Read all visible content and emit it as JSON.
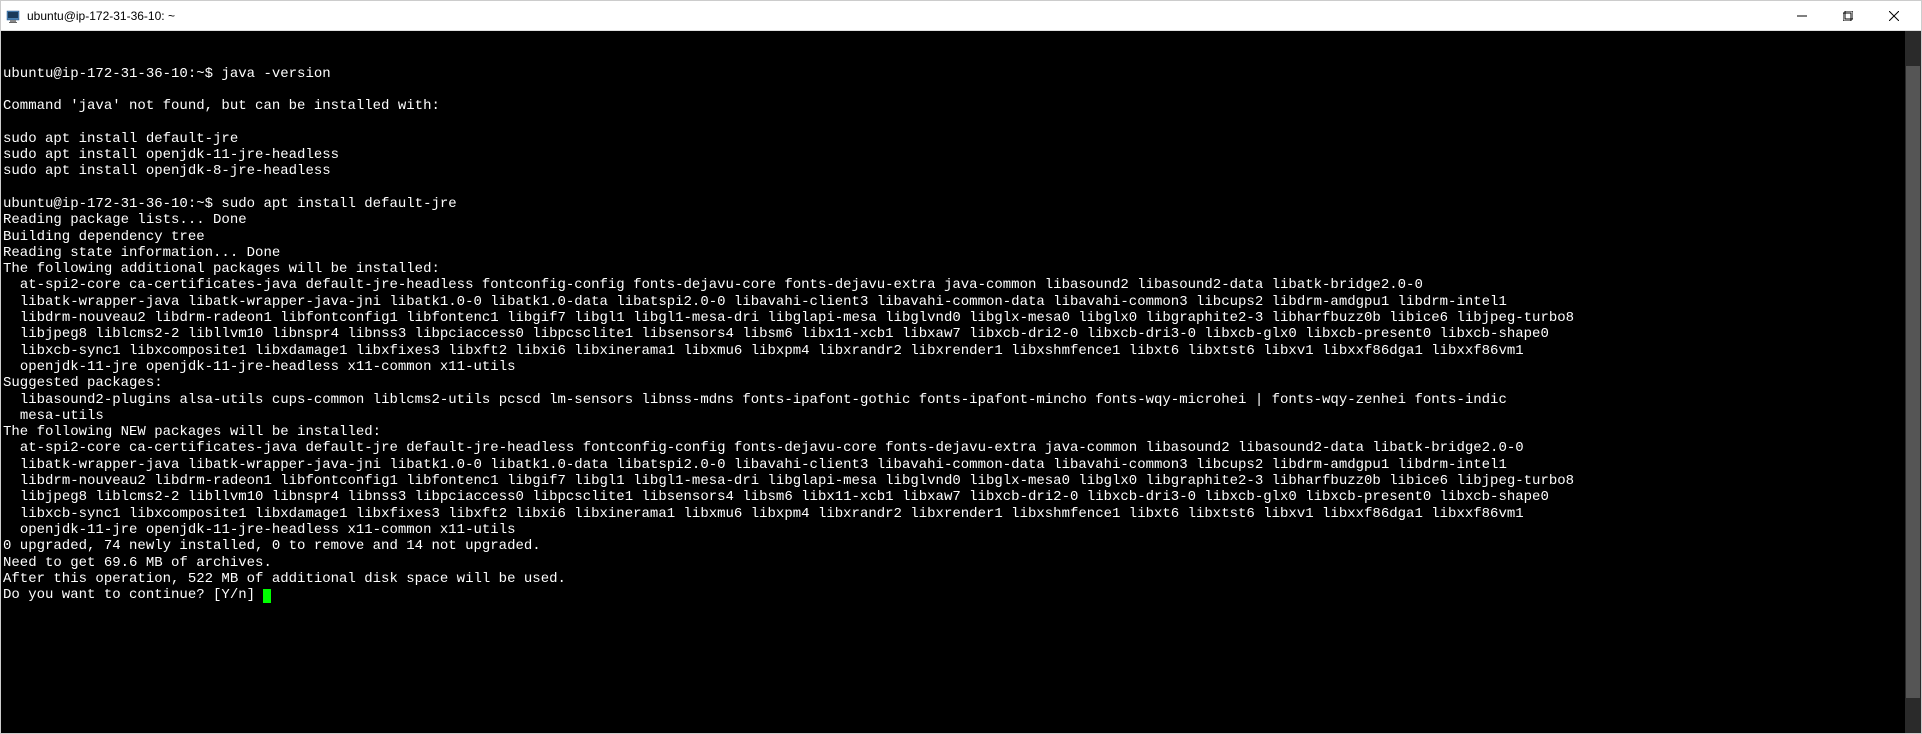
{
  "window": {
    "title": "ubuntu@ip-172-31-36-10: ~"
  },
  "terminal": {
    "lines": [
      "ubuntu@ip-172-31-36-10:~$ java -version",
      "",
      "Command 'java' not found, but can be installed with:",
      "",
      "sudo apt install default-jre",
      "sudo apt install openjdk-11-jre-headless",
      "sudo apt install openjdk-8-jre-headless",
      "",
      "ubuntu@ip-172-31-36-10:~$ sudo apt install default-jre",
      "Reading package lists... Done",
      "Building dependency tree",
      "Reading state information... Done",
      "The following additional packages will be installed:",
      "  at-spi2-core ca-certificates-java default-jre-headless fontconfig-config fonts-dejavu-core fonts-dejavu-extra java-common libasound2 libasound2-data libatk-bridge2.0-0",
      "  libatk-wrapper-java libatk-wrapper-java-jni libatk1.0-0 libatk1.0-data libatspi2.0-0 libavahi-client3 libavahi-common-data libavahi-common3 libcups2 libdrm-amdgpu1 libdrm-intel1",
      "  libdrm-nouveau2 libdrm-radeon1 libfontconfig1 libfontenc1 libgif7 libgl1 libgl1-mesa-dri libglapi-mesa libglvnd0 libglx-mesa0 libglx0 libgraphite2-3 libharfbuzz0b libice6 libjpeg-turbo8",
      "  libjpeg8 liblcms2-2 libllvm10 libnspr4 libnss3 libpciaccess0 libpcsclite1 libsensors4 libsm6 libx11-xcb1 libxaw7 libxcb-dri2-0 libxcb-dri3-0 libxcb-glx0 libxcb-present0 libxcb-shape0",
      "  libxcb-sync1 libxcomposite1 libxdamage1 libxfixes3 libxft2 libxi6 libxinerama1 libxmu6 libxpm4 libxrandr2 libxrender1 libxshmfence1 libxt6 libxtst6 libxv1 libxxf86dga1 libxxf86vm1",
      "  openjdk-11-jre openjdk-11-jre-headless x11-common x11-utils",
      "Suggested packages:",
      "  libasound2-plugins alsa-utils cups-common liblcms2-utils pcscd lm-sensors libnss-mdns fonts-ipafont-gothic fonts-ipafont-mincho fonts-wqy-microhei | fonts-wqy-zenhei fonts-indic",
      "  mesa-utils",
      "The following NEW packages will be installed:",
      "  at-spi2-core ca-certificates-java default-jre default-jre-headless fontconfig-config fonts-dejavu-core fonts-dejavu-extra java-common libasound2 libasound2-data libatk-bridge2.0-0",
      "  libatk-wrapper-java libatk-wrapper-java-jni libatk1.0-0 libatk1.0-data libatspi2.0-0 libavahi-client3 libavahi-common-data libavahi-common3 libcups2 libdrm-amdgpu1 libdrm-intel1",
      "  libdrm-nouveau2 libdrm-radeon1 libfontconfig1 libfontenc1 libgif7 libgl1 libgl1-mesa-dri libglapi-mesa libglvnd0 libglx-mesa0 libglx0 libgraphite2-3 libharfbuzz0b libice6 libjpeg-turbo8",
      "  libjpeg8 liblcms2-2 libllvm10 libnspr4 libnss3 libpciaccess0 libpcsclite1 libsensors4 libsm6 libx11-xcb1 libxaw7 libxcb-dri2-0 libxcb-dri3-0 libxcb-glx0 libxcb-present0 libxcb-shape0",
      "  libxcb-sync1 libxcomposite1 libxdamage1 libxfixes3 libxft2 libxi6 libxinerama1 libxmu6 libxpm4 libxrandr2 libxrender1 libxshmfence1 libxt6 libxtst6 libxv1 libxxf86dga1 libxxf86vm1",
      "  openjdk-11-jre openjdk-11-jre-headless x11-common x11-utils",
      "0 upgraded, 74 newly installed, 0 to remove and 14 not upgraded.",
      "Need to get 69.6 MB of archives.",
      "After this operation, 522 MB of additional disk space will be used.",
      "Do you want to continue? [Y/n] "
    ]
  }
}
